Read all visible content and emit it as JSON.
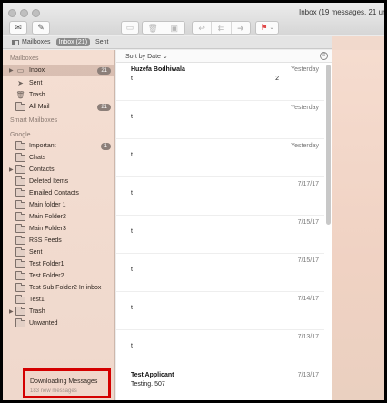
{
  "window": {
    "title": "Inbox (19 messages, 21 un"
  },
  "toolbar": {
    "compose_icon": "compose-icon",
    "mailbox_icon": "envelope-icon",
    "archive_icon": "archive-icon",
    "delete_icon": "trash-icon",
    "junk_icon": "junk-icon",
    "reply_icon": "reply-icon",
    "reply_all_icon": "reply-all-icon",
    "forward_icon": "forward-icon",
    "flag_icon": "flag-icon"
  },
  "favorites": {
    "mailboxes_label": "Mailboxes",
    "inbox_label": "Inbox (21)",
    "sent_label": "Sent"
  },
  "sidebar": {
    "mailboxes_header": "Mailboxes",
    "mailbox_items": [
      {
        "label": "Inbox",
        "badge": "21"
      },
      {
        "label": "Sent"
      },
      {
        "label": "Trash"
      },
      {
        "label": "All Mail",
        "badge": "21"
      }
    ],
    "smart_header": "Smart Mailboxes",
    "google_header": "Google",
    "google_items": [
      {
        "label": "Important",
        "badge": "1"
      },
      {
        "label": "Chats"
      },
      {
        "label": "Contacts"
      },
      {
        "label": "Deleted Items"
      },
      {
        "label": "Emailed Contacts"
      },
      {
        "label": "Main folder 1"
      },
      {
        "label": "Main Folder2"
      },
      {
        "label": "Main Folder3"
      },
      {
        "label": "RSS Feeds"
      },
      {
        "label": "Sent"
      },
      {
        "label": "Test Folder1"
      },
      {
        "label": "Test Folder2"
      },
      {
        "label": "Test Sub Folder2 In inbox"
      },
      {
        "label": "Test1"
      },
      {
        "label": "Trash"
      },
      {
        "label": "Unwanted"
      }
    ],
    "status_title": "Downloading Messages",
    "status_sub": "183 new messages"
  },
  "list": {
    "sort_label": "Sort by Date ⌄",
    "messages": [
      {
        "from": "Huzefa Bodhiwala",
        "date": "Yesterday",
        "subject": "t",
        "extra": "2"
      },
      {
        "from": "",
        "date": "Yesterday",
        "subject": "t",
        "extra": ""
      },
      {
        "from": "",
        "date": "Yesterday",
        "subject": "t",
        "extra": ""
      },
      {
        "from": "",
        "date": "7/17/17",
        "subject": "t",
        "extra": ""
      },
      {
        "from": "",
        "date": "7/15/17",
        "subject": "t",
        "extra": ""
      },
      {
        "from": "",
        "date": "7/15/17",
        "subject": "t",
        "extra": ""
      },
      {
        "from": "",
        "date": "7/14/17",
        "subject": "t",
        "extra": ""
      },
      {
        "from": "",
        "date": "7/13/17",
        "subject": "t",
        "extra": ""
      },
      {
        "from": "Test Applicant",
        "date": "7/13/17",
        "subject": "Testing. 507",
        "extra": ""
      }
    ]
  }
}
